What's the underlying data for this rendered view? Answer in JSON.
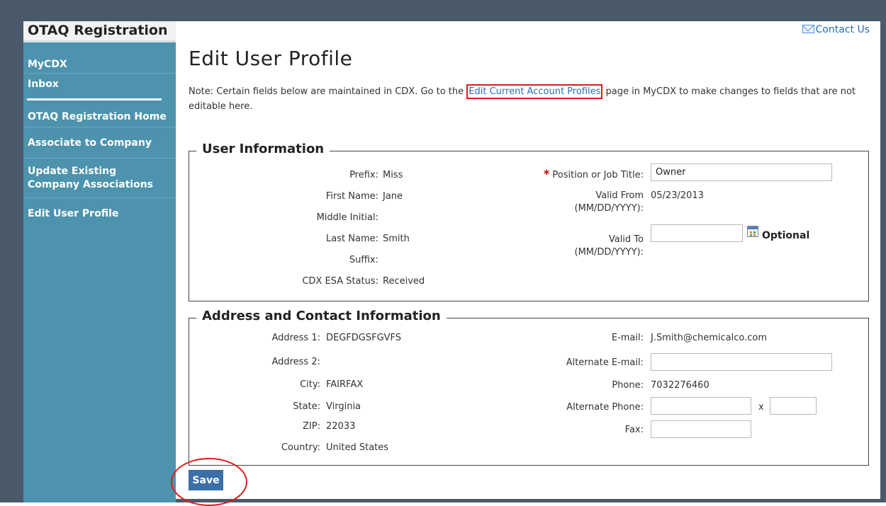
{
  "app": {
    "title": "OTAQ Registration",
    "contact_label": "Contact Us"
  },
  "sidebar": {
    "items": [
      {
        "label": "MyCDX"
      },
      {
        "label": "Inbox"
      },
      {
        "label": "OTAQ Registration Home"
      },
      {
        "label": "Associate to Company"
      },
      {
        "label": "Update Existing Company Associations"
      },
      {
        "label": "Edit User Profile"
      }
    ]
  },
  "page": {
    "title": "Edit User Profile",
    "note_before": "Note: Certain fields below are maintained in CDX. Go to the ",
    "note_link": "Edit Current Account Profiles",
    "note_after": " page in MyCDX to make changes to fields that are not editable here."
  },
  "user_info": {
    "legend": "User Information",
    "prefix_label": "Prefix:",
    "prefix": "Miss",
    "first_name_label": "First Name:",
    "first_name": "Jane",
    "middle_initial_label": "Middle Initial:",
    "middle_initial": "",
    "last_name_label": "Last Name:",
    "last_name": "Smith",
    "suffix_label": "Suffix:",
    "suffix": "",
    "esa_label": "CDX ESA Status:",
    "esa_status": "Received",
    "required_marker": "*",
    "position_label": "Position or Job Title:",
    "position": "Owner",
    "valid_from_label": "Valid From",
    "valid_from_format": "(MM/DD/YYYY):",
    "valid_from": "05/23/2013",
    "valid_to_label": "Valid To",
    "valid_to_format": "(MM/DD/YYYY):",
    "valid_to": "",
    "optional_label": "Optional"
  },
  "address_info": {
    "legend": "Address and Contact Information",
    "address1_label": "Address 1:",
    "address1": "DEGFDGSFGVFS",
    "address2_label": "Address 2:",
    "address2": "",
    "city_label": "City:",
    "city": "FAIRFAX",
    "state_label": "State:",
    "state": "Virginia",
    "zip_label": "ZIP:",
    "zip": "22033",
    "country_label": "Country:",
    "country": "United States",
    "email_label": "E-mail:",
    "email": "J.Smith@chemicalco.com",
    "alt_email_label": "Alternate E-mail:",
    "alt_email": "",
    "phone_label": "Phone:",
    "phone": "7032276460",
    "alt_phone_label": "Alternate Phone:",
    "alt_phone": "",
    "ext_label": "x",
    "ext": "",
    "fax_label": "Fax:",
    "fax": ""
  },
  "actions": {
    "save_label": "Save"
  }
}
